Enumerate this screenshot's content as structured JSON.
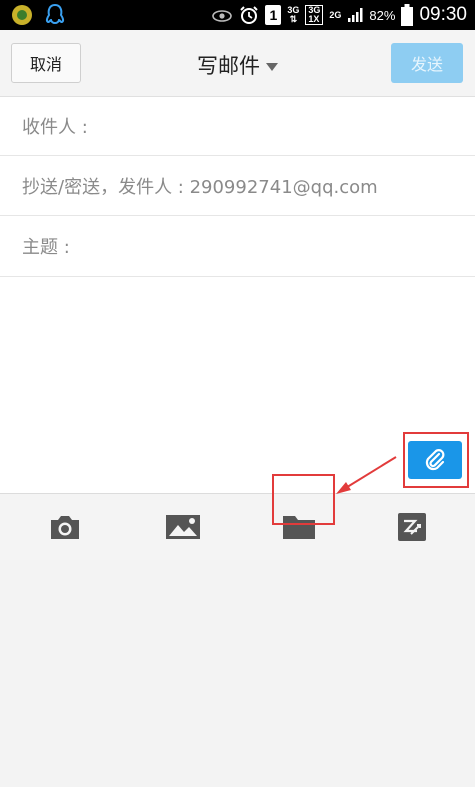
{
  "status_bar": {
    "network_3g": "3G",
    "network_1x": "1X",
    "network_2g": "2G",
    "sim_slot": "1",
    "battery_percent": "82%",
    "time": "09:30"
  },
  "header": {
    "cancel_label": "取消",
    "title": "写邮件",
    "send_label": "发送"
  },
  "fields": {
    "to_label": "收件人 :",
    "cc_label": "抄送/密送，发件人 : 290992741@qq.com",
    "subject_label": "主题 :"
  },
  "toolbar": {
    "items": [
      "camera-icon",
      "image-icon",
      "folder-icon",
      "scan-edit-icon"
    ]
  },
  "colors": {
    "accent": "#1a96e8",
    "send_disabled": "#8ecdf2",
    "annotation": "#e23b3b"
  }
}
